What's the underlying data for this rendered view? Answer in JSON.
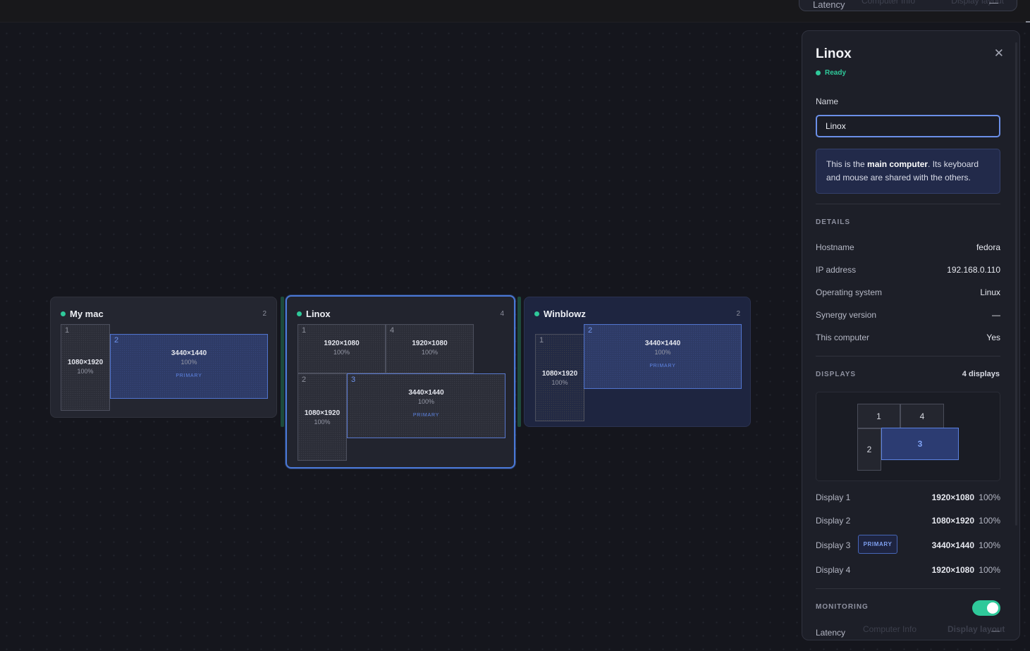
{
  "top": {
    "latency_label": "Latency",
    "latency_value": "—",
    "ghost_tab1": "Computer Info",
    "ghost_tab2": "Display layout"
  },
  "computers": [
    {
      "name": "My mac",
      "count": "2",
      "displays": [
        {
          "num": "1",
          "res": "1080×1920",
          "pct": "100%"
        },
        {
          "num": "2",
          "res": "3440×1440",
          "pct": "100%",
          "primary": "PRIMARY"
        }
      ]
    },
    {
      "name": "Linox",
      "count": "4",
      "displays": [
        {
          "num": "1",
          "res": "1920×1080",
          "pct": "100%"
        },
        {
          "num": "4",
          "res": "1920×1080",
          "pct": "100%"
        },
        {
          "num": "2",
          "res": "1080×1920",
          "pct": "100%"
        },
        {
          "num": "3",
          "res": "3440×1440",
          "pct": "100%",
          "primary": "PRIMARY"
        }
      ]
    },
    {
      "name": "Winblowz",
      "count": "2",
      "displays": [
        {
          "num": "1",
          "res": "1080×1920",
          "pct": "100%"
        },
        {
          "num": "2",
          "res": "3440×1440",
          "pct": "100%",
          "primary": "PRIMARY"
        }
      ]
    }
  ],
  "panel": {
    "title": "Linox",
    "status": "Ready",
    "name_label": "Name",
    "name_value": "Linox",
    "info_pre": "This is the ",
    "info_bold": "main computer",
    "info_post": ". Its keyboard and mouse are shared with the others.",
    "details_heading": "DETAILS",
    "details": [
      {
        "label": "Hostname",
        "value": "fedora"
      },
      {
        "label": "IP address",
        "value": "192.168.0.110"
      },
      {
        "label": "Operating system",
        "value": "Linux"
      },
      {
        "label": "Synergy version",
        "value": "—"
      },
      {
        "label": "This computer",
        "value": "Yes"
      }
    ],
    "displays_heading": "DISPLAYS",
    "displays_count": "4 displays",
    "mini_labels": [
      "1",
      "4",
      "2",
      "3"
    ],
    "display_rows": [
      {
        "label": "Display 1",
        "res": "1920×1080",
        "pct": "100%"
      },
      {
        "label": "Display 2",
        "res": "1080×1920",
        "pct": "100%"
      },
      {
        "label": "Display 3",
        "res": "3440×1440",
        "pct": "100%",
        "badge": "PRIMARY"
      },
      {
        "label": "Display 4",
        "res": "1920×1080",
        "pct": "100%"
      }
    ],
    "monitoring_heading": "MONITORING",
    "monitoring_enabled": true,
    "latency_label": "Latency",
    "latency_value": "—",
    "tab1": "Computer Info",
    "tab2": "Display layout"
  },
  "colors": {
    "accent": "#4a78d6",
    "ready": "#2fc99a",
    "background": "#15161d",
    "panel": "#1d1f28"
  }
}
